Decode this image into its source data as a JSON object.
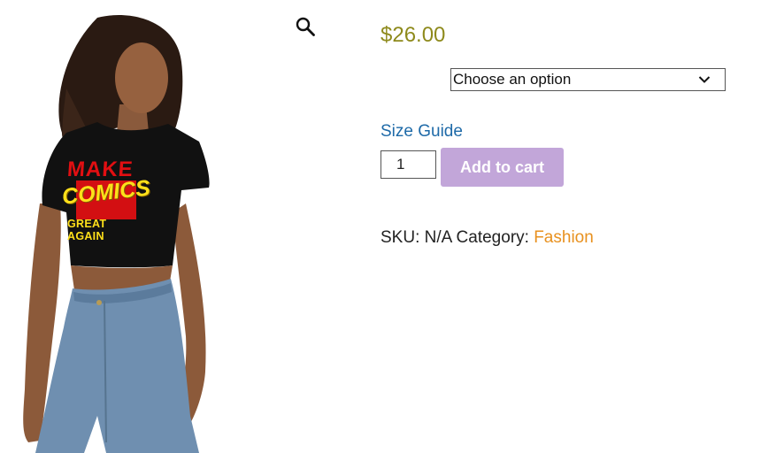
{
  "product": {
    "tee_print": {
      "line1": "MAKE",
      "line2": "COMICS",
      "line3": "GREAT AGAIN"
    },
    "price": "$26.00",
    "variation_select": {
      "selected": "Choose an option"
    },
    "size_guide_label": "Size Guide",
    "quantity": "1",
    "add_to_cart_label": "Add to cart",
    "meta": {
      "sku_label": "SKU:",
      "sku_value": "N/A",
      "category_label": "Category:",
      "category_value": "Fashion"
    }
  },
  "icons": {
    "zoom": "magnifier-icon",
    "select_arrow": "chevron-down-icon"
  },
  "colors": {
    "price": "#8e8a1c",
    "link_blue": "#1e6aa8",
    "category_orange": "#e8911f",
    "button_purple": "#c2a6d9"
  }
}
